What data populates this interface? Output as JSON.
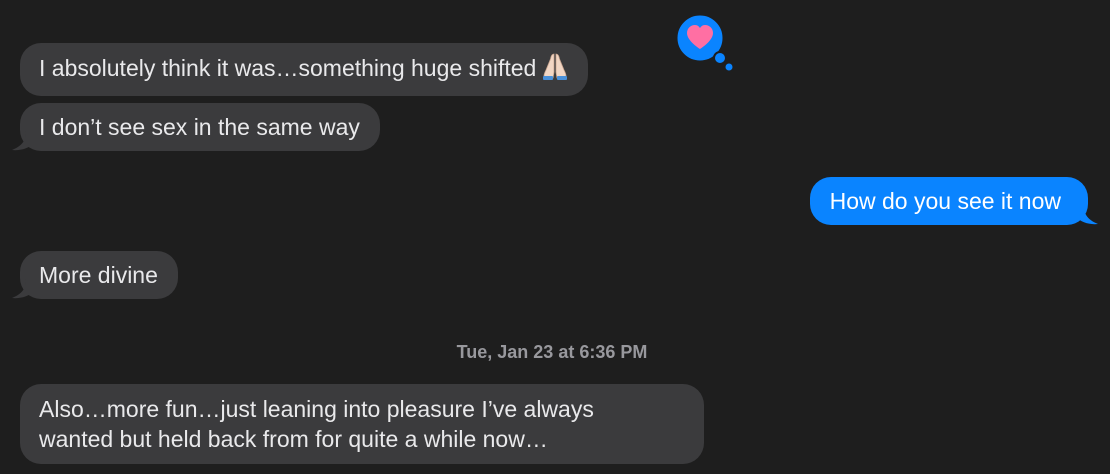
{
  "messages": [
    {
      "text": "I absolutely think it was…something huge shifted",
      "sender": "them"
    },
    {
      "text": "I don’t see sex in the same way",
      "sender": "them"
    },
    {
      "text": "How do you see it now",
      "sender": "me"
    },
    {
      "text": "More divine",
      "sender": "them"
    },
    {
      "lines": [
        "Also…more fun…just leaning into pleasure I’ve always",
        "wanted but held back from for quite a while now…"
      ],
      "sender": "them"
    }
  ],
  "timestamp": {
    "day": "Tue, Jan 23 at",
    "time": "6:36 PM"
  },
  "reaction": {
    "icon": "heart-icon",
    "color": "#ff6fa3",
    "bubble_color": "#0a84ff"
  },
  "emoji": {
    "icon": "folded-hands-icon"
  },
  "colors": {
    "background": "#1e1e1e",
    "incoming_bubble": "#3b3b3d",
    "outgoing_bubble": "#0a84ff",
    "text": "#e9e9eb",
    "timestamp": "#98989d"
  }
}
